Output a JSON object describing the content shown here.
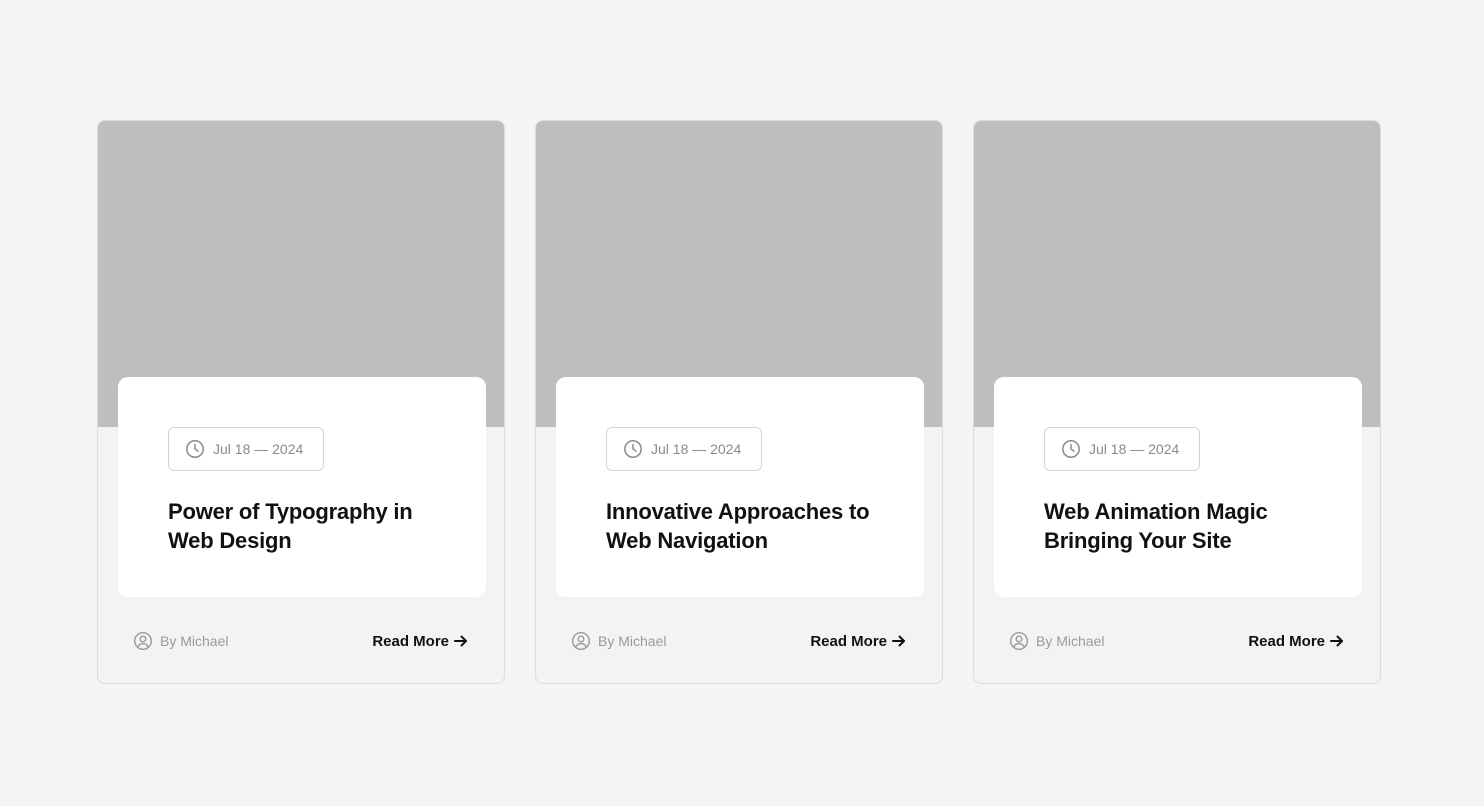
{
  "cards": [
    {
      "date": "Jul 18 — 2024",
      "title": "Power of Typography in Web Design",
      "author": "By Michael",
      "cta": "Read More"
    },
    {
      "date": "Jul 18 — 2024",
      "title": "Innovative Approaches to Web Navigation",
      "author": "By Michael",
      "cta": "Read More"
    },
    {
      "date": "Jul 18 — 2024",
      "title": "Web Animation Magic Bringing Your Site",
      "author": "By Michael",
      "cta": "Read More"
    }
  ],
  "icons": {
    "date": "clock-icon",
    "author": "user-circle-icon",
    "cta": "arrow-right-icon"
  },
  "colors": {
    "page_background": "#f4f4f4",
    "image_placeholder": "#bdbebf",
    "card_body": "#ffffff",
    "title_text": "#111111",
    "meta_text": "#8a8a8a"
  }
}
